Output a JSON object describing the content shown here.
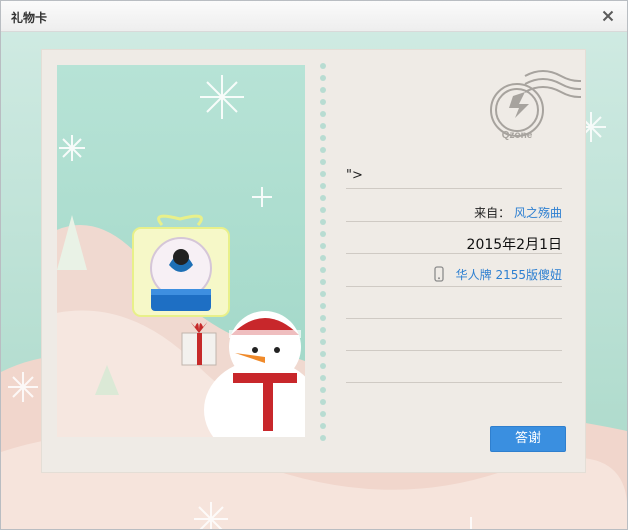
{
  "window": {
    "title": "礼物卡"
  },
  "card": {
    "note_line": "\">",
    "from_label": "来自：",
    "from_name": "风之殇曲",
    "date": "2015年2月1日",
    "device_text": "华人牌 2155版傻妞",
    "stamp_text": "Qzone",
    "thanks_label": "答谢"
  },
  "icons": {
    "close": "close-icon",
    "phone": "phone-icon",
    "stamp": "qzone-stamp-icon",
    "gift": "snow-globe-gift-icon"
  },
  "colors": {
    "link": "#2d7fd1",
    "button": "#3a8fe0",
    "background": "#cfe9e2"
  }
}
